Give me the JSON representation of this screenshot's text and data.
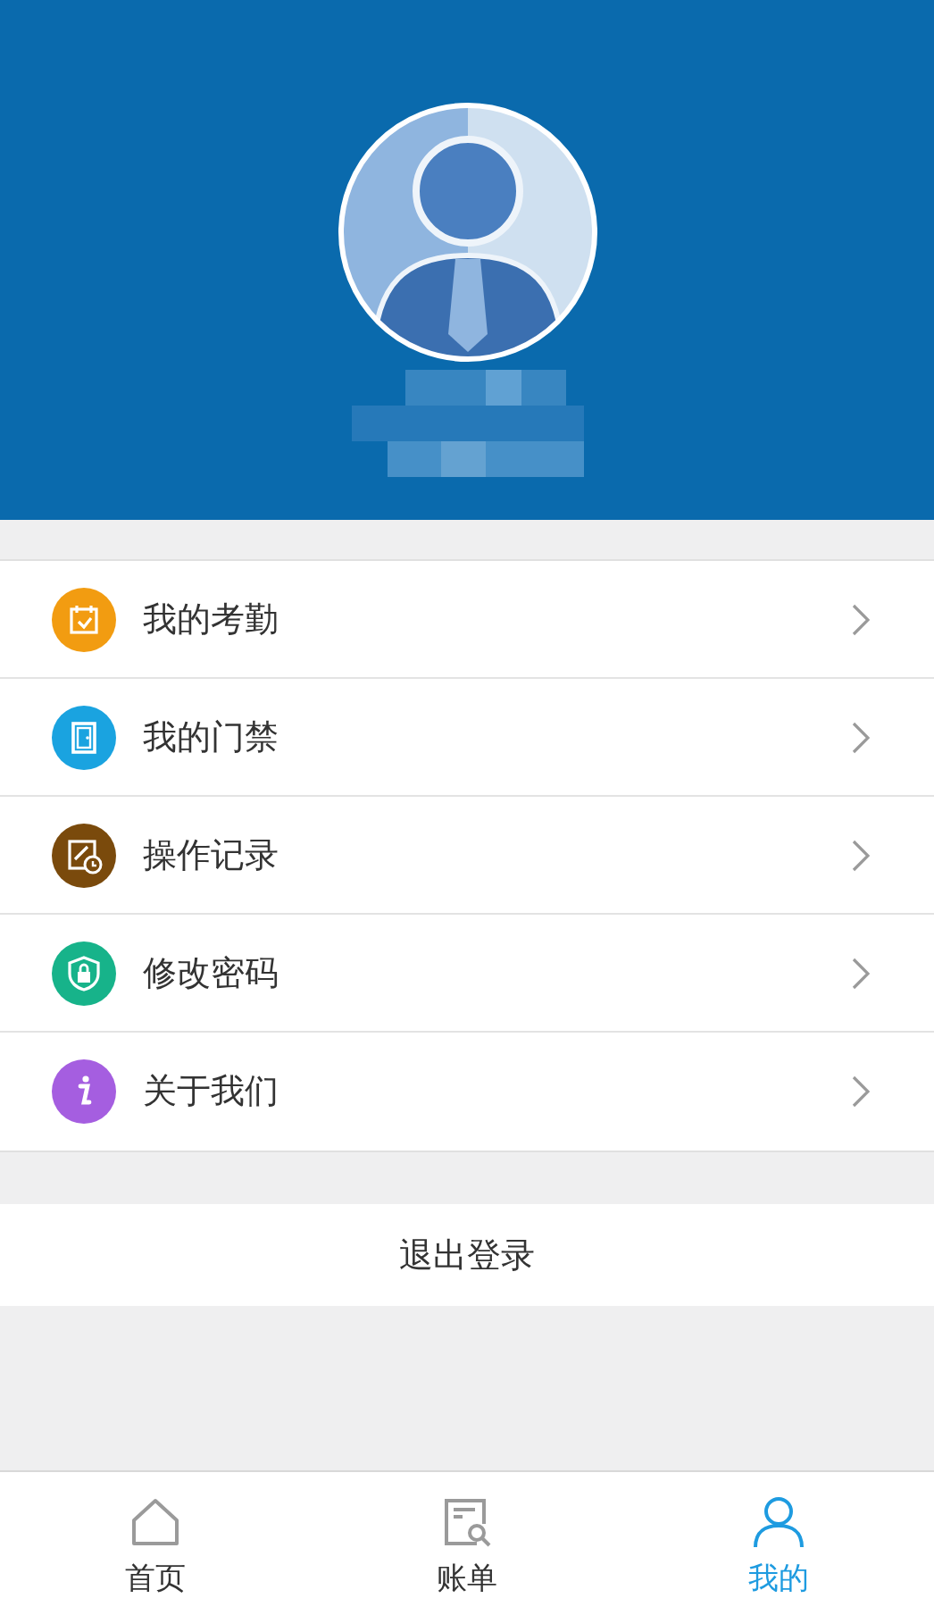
{
  "menu": [
    {
      "kind": "calendar",
      "label": "我的考勤",
      "color": "#f29c11"
    },
    {
      "kind": "door",
      "label": "我的门禁",
      "color": "#1aa3e0"
    },
    {
      "kind": "record",
      "label": "操作记录",
      "color": "#7a4a0c"
    },
    {
      "kind": "lock",
      "label": "修改密码",
      "color": "#17b38a"
    },
    {
      "kind": "info",
      "label": "关于我们",
      "color": "#a55ee0"
    }
  ],
  "logout": "退出登录",
  "tabs": [
    {
      "kind": "home",
      "label": "首页",
      "selected": false
    },
    {
      "kind": "bill",
      "label": "账单",
      "selected": false
    },
    {
      "kind": "person",
      "label": "我的",
      "selected": true
    }
  ]
}
